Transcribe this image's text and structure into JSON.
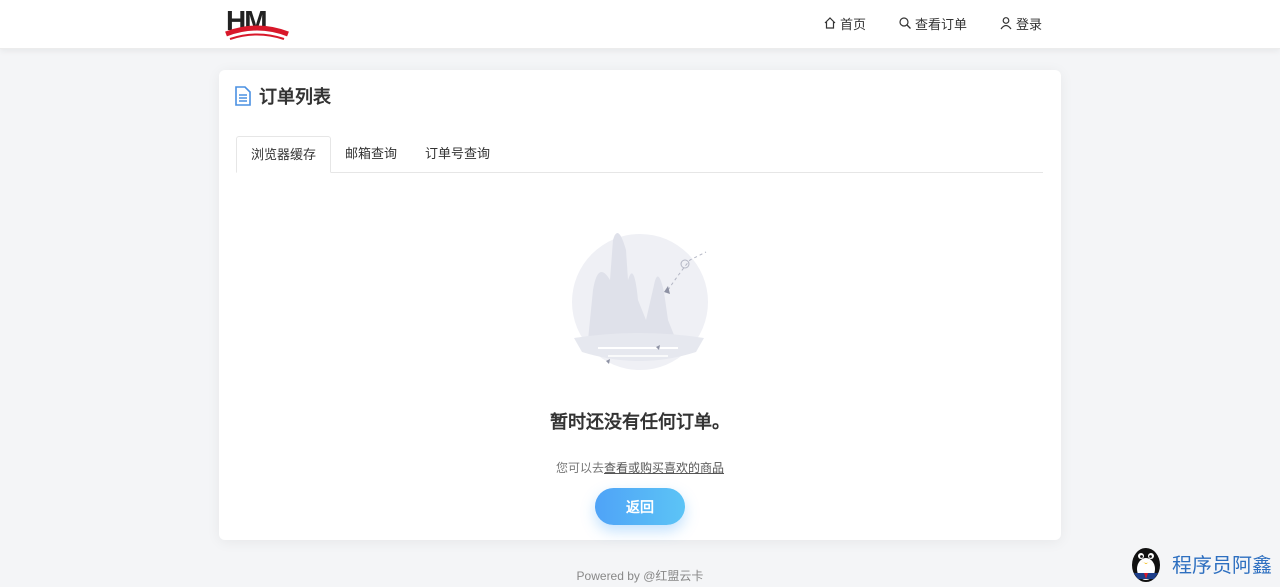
{
  "logo": {
    "text": "HM"
  },
  "nav": {
    "home": "首页",
    "orders": "查看订单",
    "login": "登录"
  },
  "card": {
    "title": "订单列表",
    "tabs": [
      "浏览器缓存",
      "邮箱查询",
      "订单号查询"
    ],
    "active_tab": 0
  },
  "empty": {
    "title": "暂时还没有任何订单。",
    "sub_prefix": "您可以去",
    "sub_link": "查看或购买喜欢的商品",
    "back_label": "返回"
  },
  "footer": {
    "text": "Powered by @红盟云卡"
  },
  "watermark": {
    "text": "程序员阿鑫"
  },
  "colors": {
    "accent": "#4fa3f7",
    "title_icon": "#4a90e2"
  }
}
